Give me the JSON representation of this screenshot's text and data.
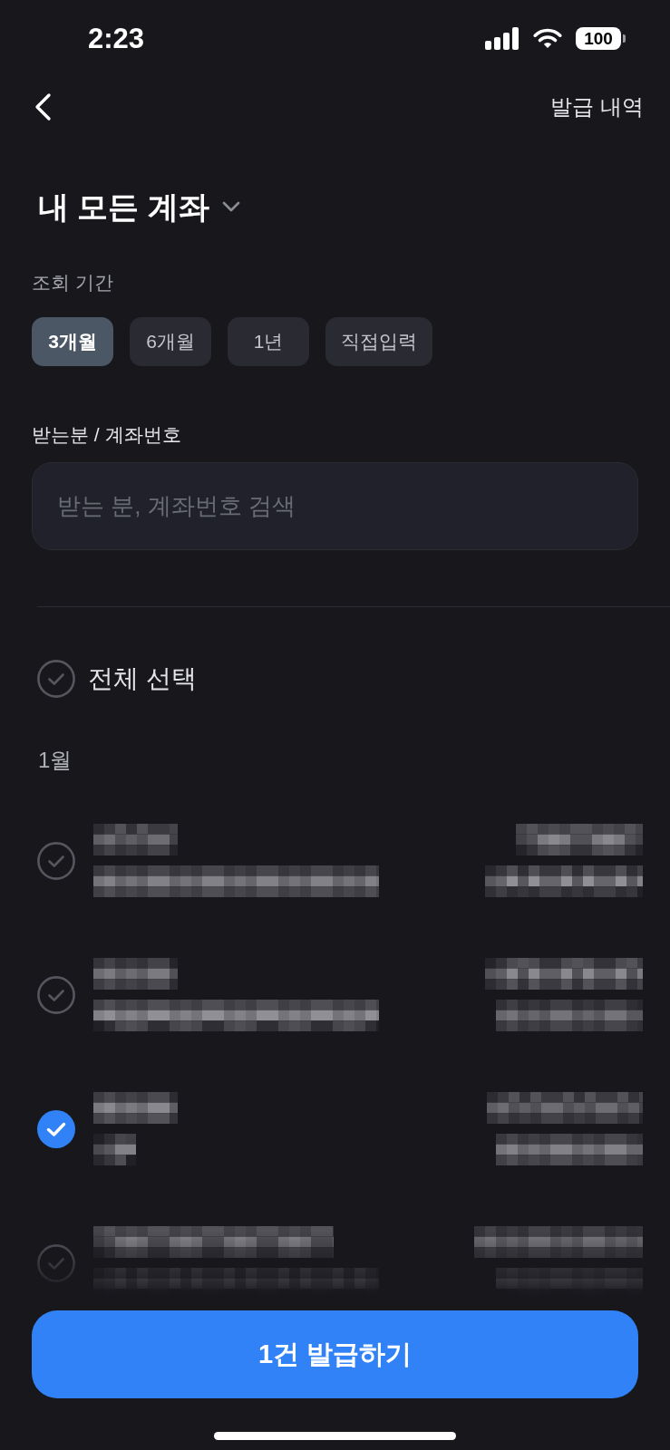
{
  "status_bar": {
    "time": "2:23",
    "battery": "100"
  },
  "header": {
    "action": "발급 내역"
  },
  "title": {
    "text": "내 모든 계좌"
  },
  "period": {
    "label": "조회 기간",
    "options": [
      {
        "label": "3개월",
        "selected": true
      },
      {
        "label": "6개월",
        "selected": false
      },
      {
        "label": "1년",
        "selected": false
      },
      {
        "label": "직접입력",
        "selected": false
      }
    ]
  },
  "search": {
    "label": "받는분 / 계좌번호",
    "placeholder": "받는 분, 계좌번호 검색"
  },
  "select_all": {
    "label": "전체 선택",
    "checked": false
  },
  "groups": [
    {
      "month": "1월",
      "rows": [
        {
          "checked": false
        },
        {
          "checked": false
        },
        {
          "checked": true
        },
        {
          "checked": false
        }
      ]
    }
  ],
  "submit_button": {
    "label": "1건 발급하기"
  }
}
